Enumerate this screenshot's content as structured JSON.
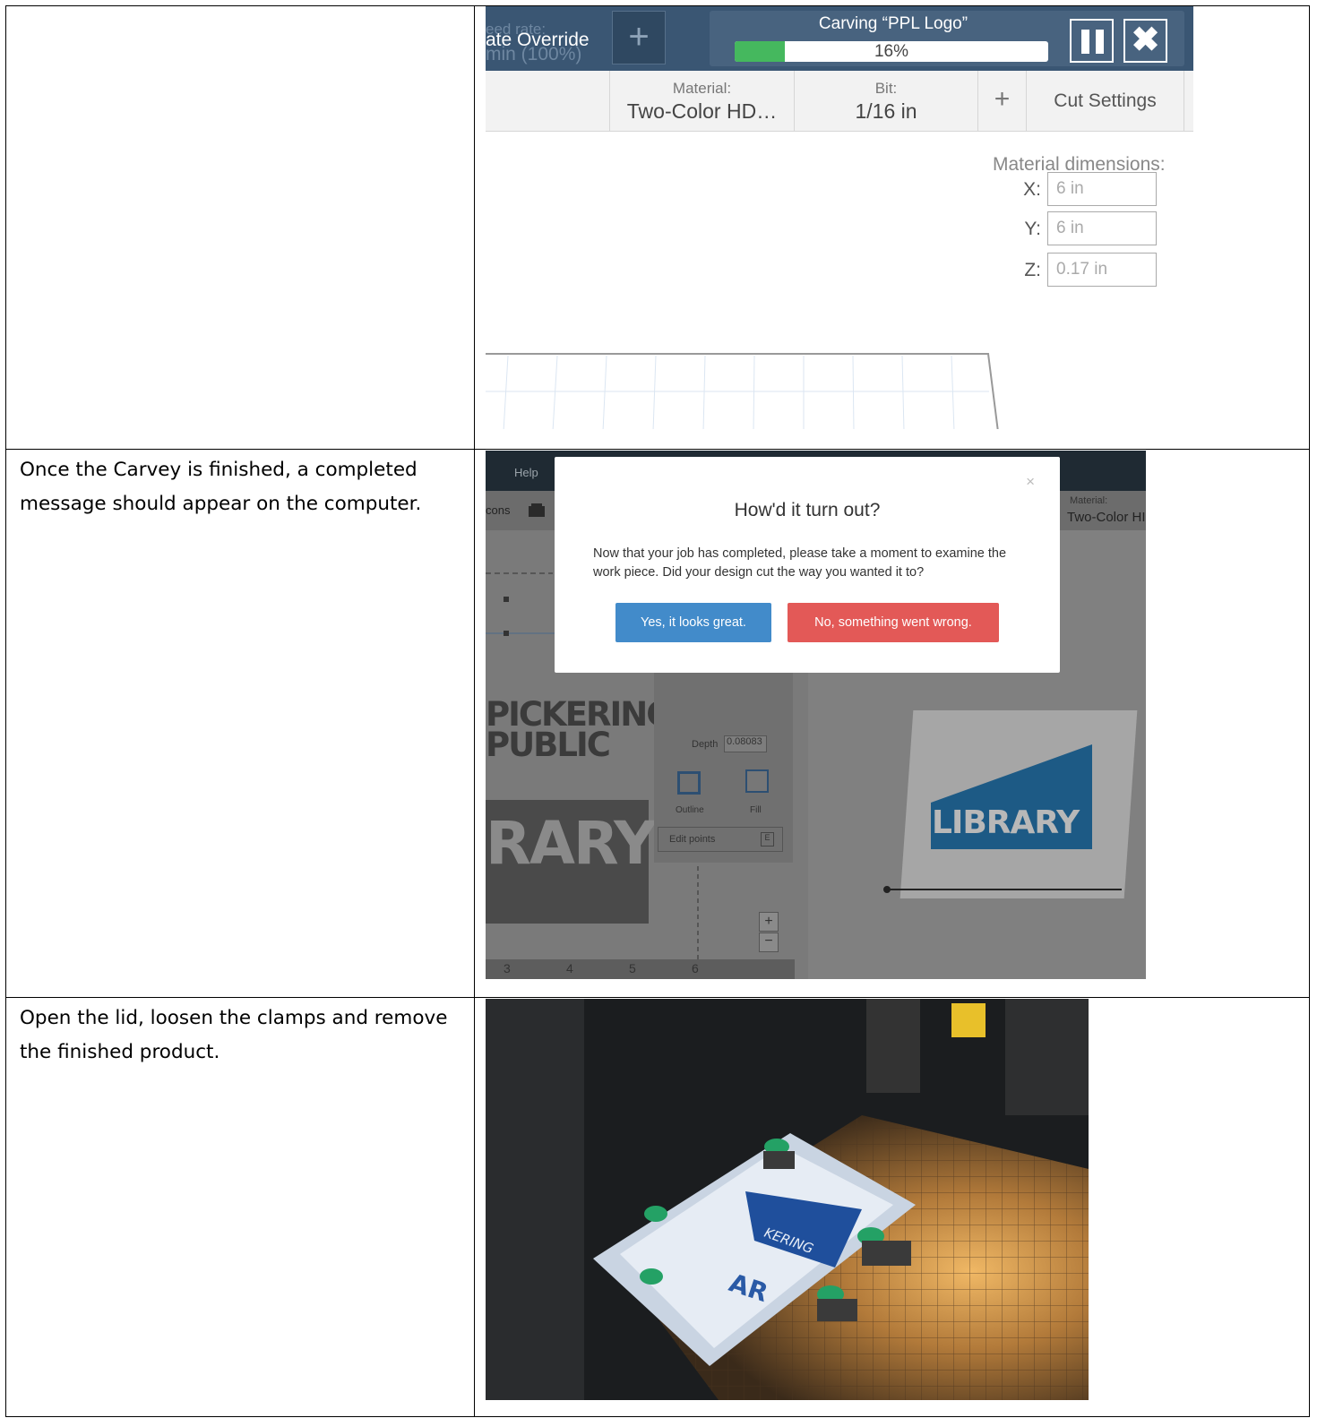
{
  "steps": [
    {
      "text": ""
    },
    {
      "text": "Once the Carvey is finished, a completed message should appear on the computer."
    },
    {
      "text": "Open the lid, loosen the clamps and remove the finished product."
    }
  ],
  "carving_screen": {
    "feed_label_partial": "eed rate:",
    "feed_value_partial": "min (100%)",
    "override_label": "ate Override",
    "add_button": "+",
    "carving_title": "Carving “PPL Logo”",
    "progress_percent": 16,
    "progress_text": "16%",
    "settings": {
      "material_label": "Material:",
      "material_value": "Two-Color HD…",
      "bit_label": "Bit:",
      "bit_value": "1/16 in",
      "plus": "+",
      "cut_settings": "Cut Settings"
    },
    "material_dimensions": {
      "title": "Material dimensions:",
      "rows": [
        {
          "label": "X:",
          "value": "6 in"
        },
        {
          "label": "Y:",
          "value": "6 in"
        },
        {
          "label": "Z:",
          "value": "0.17 in"
        }
      ]
    }
  },
  "dialog_screen": {
    "menu_help": "Help",
    "toolbar_partial": "cons",
    "material_label": "Material:",
    "material_value": "Two-Color HI",
    "dialog_title": "How'd it turn out?",
    "dialog_body": "Now that your job has completed, please take a moment to examine the work piece. Did your design cut the way you wanted it to?",
    "yes_button": "Yes, it looks great.",
    "no_button": "No, something went wrong.",
    "close_glyph": "×",
    "canvas_text_1": "PICKERING",
    "canvas_text_2": "PUBLIC",
    "canvas_text_3": "RARY",
    "preview_text": "LIBRARY",
    "depth_label": "Depth",
    "depth_value": "0.08083",
    "outline_label": "Outline",
    "fill_label": "Fill",
    "edit_points": "Edit points",
    "edit_key": "E",
    "ruler": [
      "3",
      "4",
      "5",
      "6"
    ]
  },
  "photo": {
    "label_text": "KERING",
    "label_text_2": "AR"
  }
}
